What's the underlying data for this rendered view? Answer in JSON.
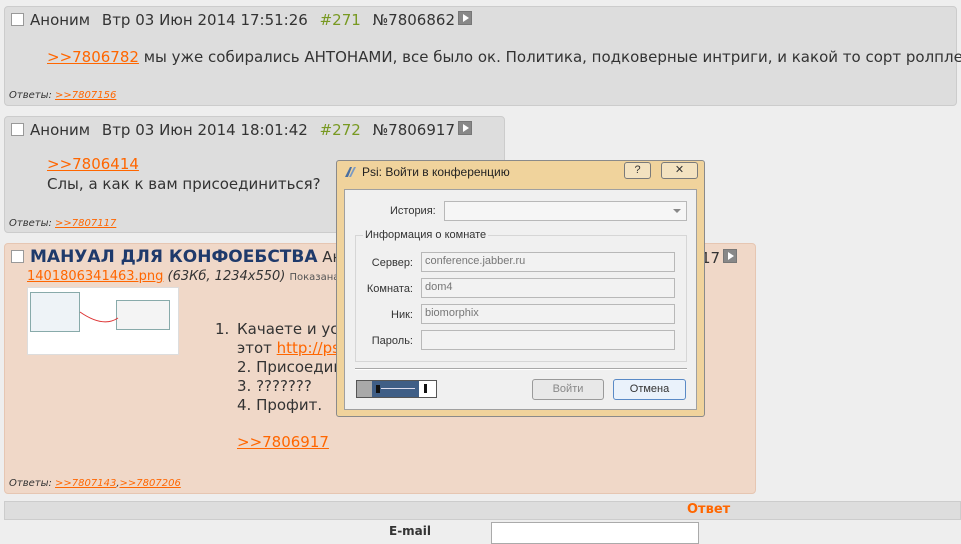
{
  "posts": [
    {
      "author": "Аноним",
      "date": "Втр 03 Июн 2014 17:51:26",
      "index": "#271",
      "id": "№7806862",
      "reply_link": ">>7806782",
      "text": "мы уже собирались АНТОНАМИ, все было ок. Политика, подковерные интриги, и какой то сорт ролплея",
      "replies_label": "Ответы:",
      "replies": [
        ">>7807156"
      ]
    },
    {
      "author": "Аноним",
      "date": "Втр 03 Июн 2014 18:01:42",
      "index": "#272",
      "id": "№7806917",
      "reply_link": ">>7806414",
      "text": "Слы, а как к вам присоединиться?",
      "replies_label": "Ответы:",
      "replies": [
        ">>7807117"
      ]
    }
  ],
  "op_post": {
    "title": "МАНУАЛ ДЛЯ КОНФОЕБСТВА",
    "author_partial": "Ан",
    "id_partial": "17",
    "file_name": "1401806341463.png",
    "file_meta": "(63Кб, 1234x550)",
    "shown_partial": "Показана у",
    "list": [
      {
        "n": "1.",
        "text": "Качаете и уст"
      },
      {
        "n": "",
        "text": "этот ",
        "link": "http://ps"
      },
      {
        "n": "",
        "text": "2. Присоедин"
      },
      {
        "n": "",
        "text": "3. ???????"
      },
      {
        "n": "",
        "text": "4. Профит."
      }
    ],
    "quote_link": ">>7806917",
    "replies_label": "Ответы:",
    "replies": [
      ">>7807143",
      ">>7807206"
    ]
  },
  "reply_form": {
    "title": "Ответ",
    "email_label": "E-mail"
  },
  "dialog": {
    "title": "Psi: Войти в конференцию",
    "help_btn": "?",
    "close_btn": "✕",
    "history_label": "История:",
    "history_value": "",
    "group_title": "Информация о комнате",
    "server_label": "Сервер:",
    "server_value": "conference.jabber.ru",
    "room_label": "Комната:",
    "room_value": "dom4",
    "nick_label": "Ник:",
    "nick_value": "biomorphix",
    "password_label": "Пароль:",
    "password_value": "",
    "join_btn": "Войти",
    "cancel_btn": "Отмена",
    "colors": {
      "frame": "#f0d39c",
      "body": "#f0f0f0"
    }
  },
  "colors": {
    "link": "#ff6600",
    "post_num": "#789922",
    "op_bg": "#f0d8c8",
    "post_bg": "#dddddd"
  }
}
